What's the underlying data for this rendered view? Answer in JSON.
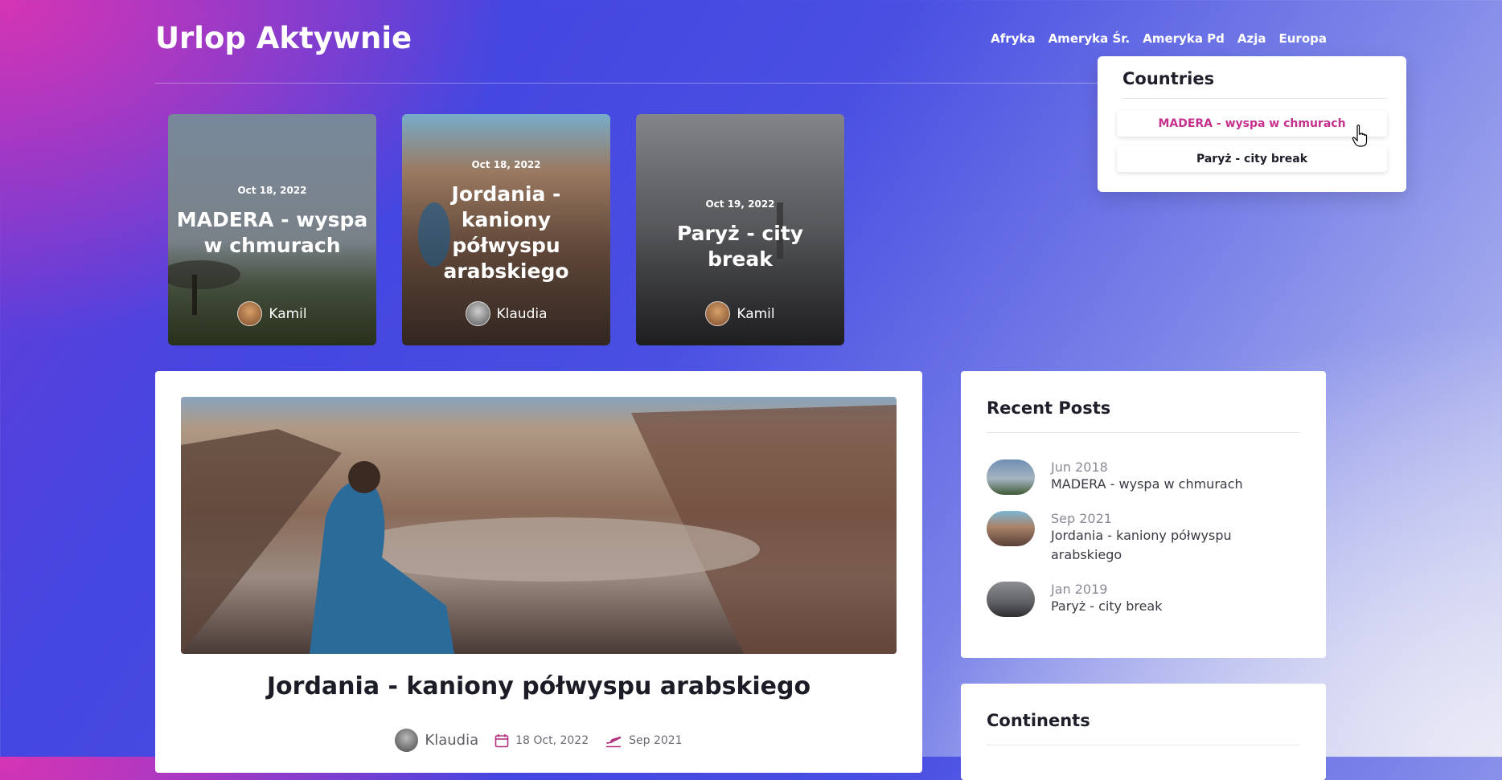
{
  "site": {
    "title": "Urlop Aktywnie"
  },
  "nav": {
    "items": [
      "Afryka",
      "Ameryka Śr.",
      "Ameryka Pd",
      "Azja",
      "Europa"
    ]
  },
  "dropdown": {
    "title": "Countries",
    "items": [
      "MADERA - wyspa w chmurach",
      "Paryż - city break"
    ]
  },
  "featured": [
    {
      "date": "Oct 18, 2022",
      "title": "MADERA - wyspa w chmurach",
      "author": "Kamil"
    },
    {
      "date": "Oct 18, 2022",
      "title": "Jordania - kaniony półwyspu arabskiego",
      "author": "Klaudia"
    },
    {
      "date": "Oct 19, 2022",
      "title": "Paryż - city break",
      "author": "Kamil"
    }
  ],
  "post": {
    "title": "Jordania - kaniony półwyspu arabskiego",
    "author": "Klaudia",
    "published": "18 Oct, 2022",
    "travel_date": "Sep 2021"
  },
  "recent": {
    "title": "Recent Posts",
    "items": [
      {
        "date": "Jun 2018",
        "title": "MADERA - wyspa w chmurach"
      },
      {
        "date": "Sep 2021",
        "title": "Jordania - kaniony półwyspu arabskiego"
      },
      {
        "date": "Jan 2019",
        "title": "Paryż - city break"
      }
    ]
  },
  "continents": {
    "title": "Continents"
  },
  "colors": {
    "accent": "#c6318e",
    "text": "#1e1f2a"
  }
}
